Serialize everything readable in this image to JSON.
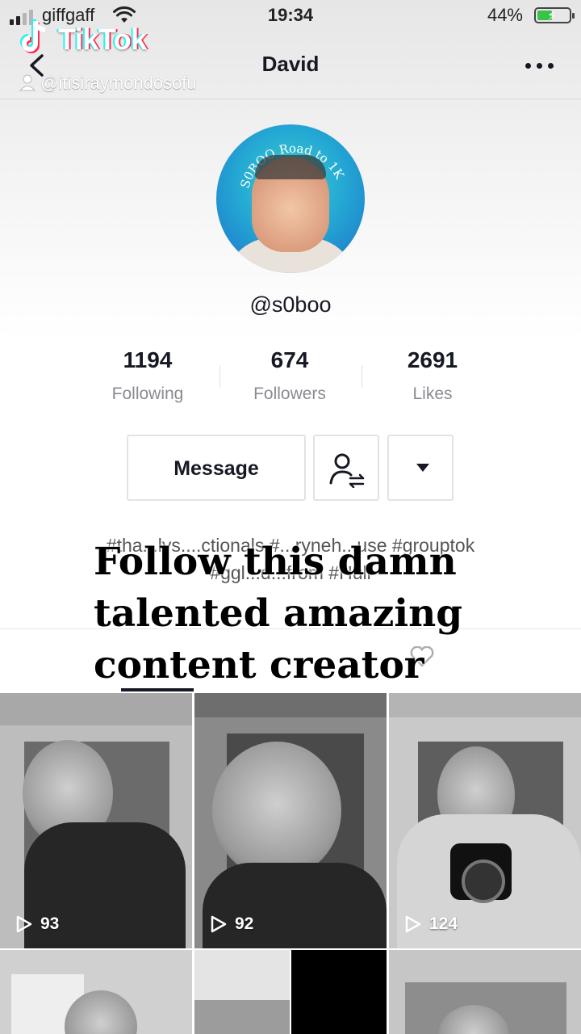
{
  "status_bar": {
    "carrier": "giffgaff",
    "time": "19:34",
    "battery_percent": "44%",
    "battery_level": 0.44,
    "signal_bars": 2,
    "signal_total": 4
  },
  "watermark": {
    "app_name": "TikTok",
    "username": "@itisiraymondosofu"
  },
  "nav": {
    "title": "David"
  },
  "profile": {
    "avatar_ring_text": "S0BOO Road to 1K",
    "handle": "@s0boo",
    "stats": [
      {
        "value": "1194",
        "label": "Following"
      },
      {
        "value": "674",
        "label": "Followers"
      },
      {
        "value": "2691",
        "label": "Likes"
      }
    ],
    "message_label": "Message",
    "bio_line1": "#tha...lys....ctionals #...ryneh...use #grouptok",
    "bio_line2": "#ggl...d...from #Hull"
  },
  "overlay_caption": {
    "line1": "Follow this damn",
    "line2": "talented amazing",
    "line3": "content creator"
  },
  "videos": [
    {
      "views": "93"
    },
    {
      "views": "92"
    },
    {
      "views": "124"
    }
  ],
  "colors": {
    "battery_fill": "#3ac24a",
    "tiktok_cyan": "#25f4ee",
    "tiktok_red": "#fe2c55"
  }
}
